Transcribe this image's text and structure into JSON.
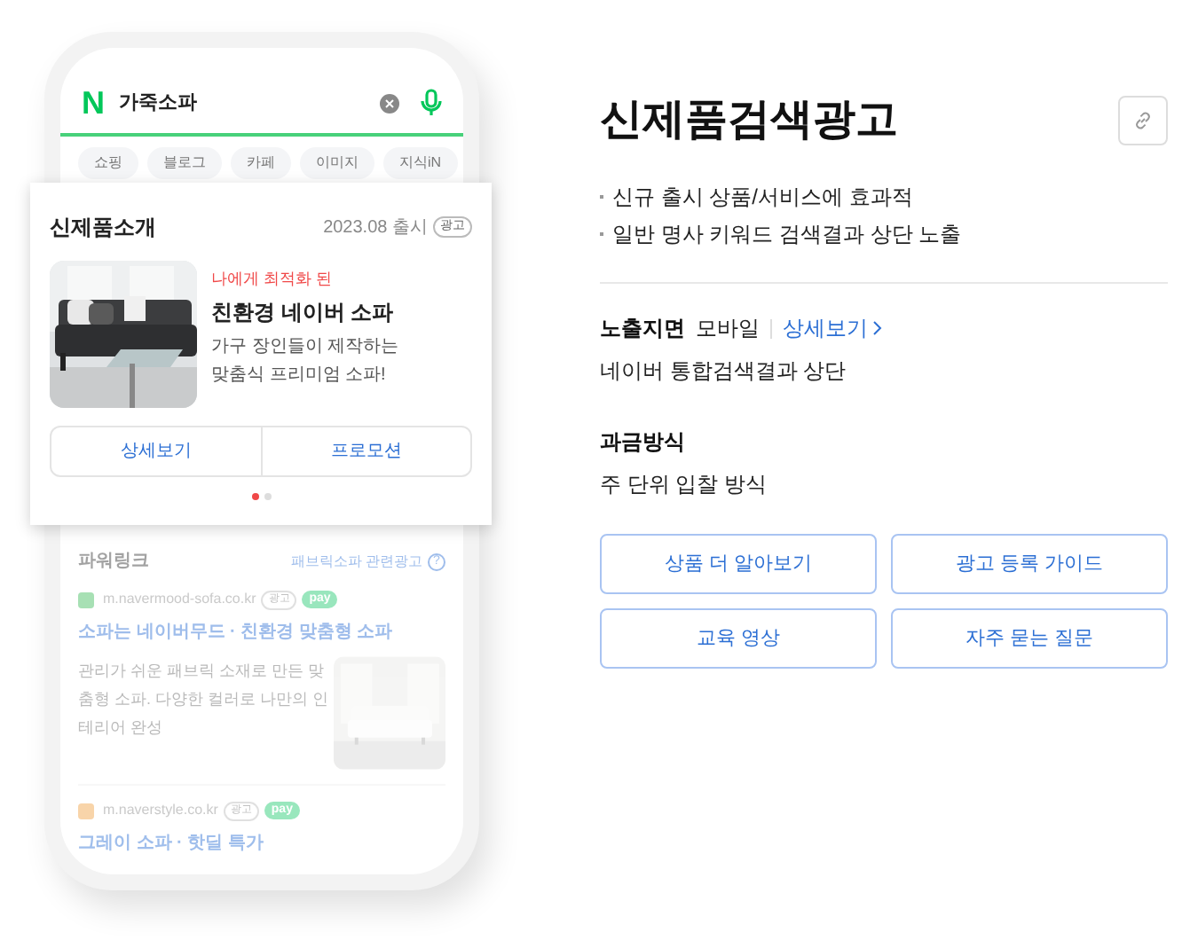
{
  "phone": {
    "search": {
      "logo": "N",
      "query": "가죽소파"
    },
    "chips": [
      "쇼핑",
      "블로그",
      "카페",
      "이미지",
      "지식iN"
    ],
    "powerlink": {
      "title": "파워링크",
      "related": "패브릭소파 관련광고",
      "help": "?",
      "ads": [
        {
          "url": "m.navermood-sofa.co.kr",
          "badge": "광고",
          "pay": "pay",
          "title": "소파는 네이버무드 · 친환경 맞춤형 소파",
          "description": "관리가 쉬운 패브릭 소재로 만든 맞춤형 소파. 다양한 컬러로 나만의 인테리어 완성",
          "kind": "full"
        },
        {
          "url": "m.naverstyle.co.kr",
          "badge": "광고",
          "pay": "pay",
          "title": "그레이 소파 · 핫딜 특가",
          "kind": "cut"
        }
      ]
    }
  },
  "promo_card": {
    "title": "신제품소개",
    "date": "2023.08 출시",
    "badge": "광고",
    "tagline": "나에게 최적화 된",
    "product": "친환경 네이버 소파",
    "description": "가구 장인들이 제작하는 맞춤식 프리미엄 소파!",
    "buttons": [
      "상세보기",
      "프로모션"
    ],
    "dots": [
      {
        "selected": true
      },
      {
        "selected": false
      }
    ]
  },
  "panel": {
    "title": "신제품검색광고",
    "bullets": [
      "신규 출시 상품/서비스에 효과적",
      "일반 명사 키워드 검색결과 상단 노출"
    ],
    "placement": {
      "label": "노출지면",
      "value": "모바일",
      "link": "상세보기",
      "detail": "네이버 통합검색결과 상단"
    },
    "billing": {
      "label": "과금방식",
      "detail": "주 단위 입찰 방식"
    },
    "buttons": [
      "상품 더 알아보기",
      "광고 등록 가이드",
      "교육 영상",
      "자주 묻는 질문"
    ]
  }
}
